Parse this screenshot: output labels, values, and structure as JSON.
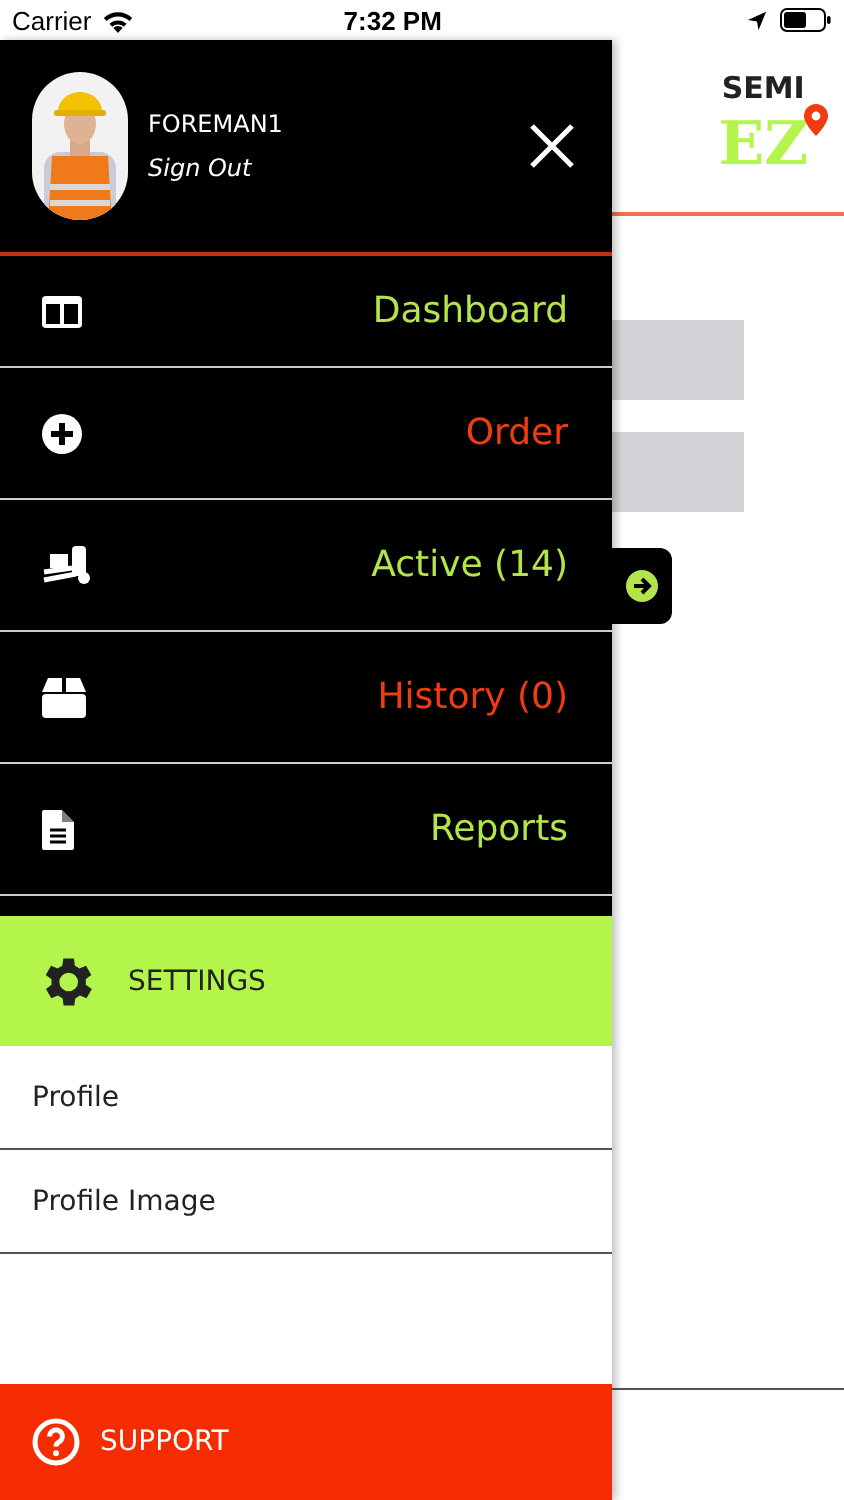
{
  "status_bar": {
    "carrier": "Carrier",
    "time": "7:32 PM"
  },
  "background_page": {
    "logo_top": "SEMI",
    "logo_bottom": "EZ"
  },
  "drawer": {
    "user": {
      "name": "FOREMAN1",
      "sign_out": "Sign Out"
    },
    "menu": [
      {
        "kind": "dashboard",
        "label": "Dashboard",
        "color": "#b3e54a"
      },
      {
        "kind": "order",
        "label": "Order",
        "color": "#f03c10"
      },
      {
        "kind": "active",
        "label": "Active (14)",
        "color": "#b3e54a"
      },
      {
        "kind": "history",
        "label": "History (0)",
        "color": "#f03c10"
      },
      {
        "kind": "reports",
        "label": "Reports",
        "color": "#b3e54a"
      }
    ],
    "settings": {
      "title": "SETTINGS",
      "items": [
        "Profile",
        "Profile Image"
      ]
    },
    "support": {
      "label": "SUPPORT"
    }
  }
}
